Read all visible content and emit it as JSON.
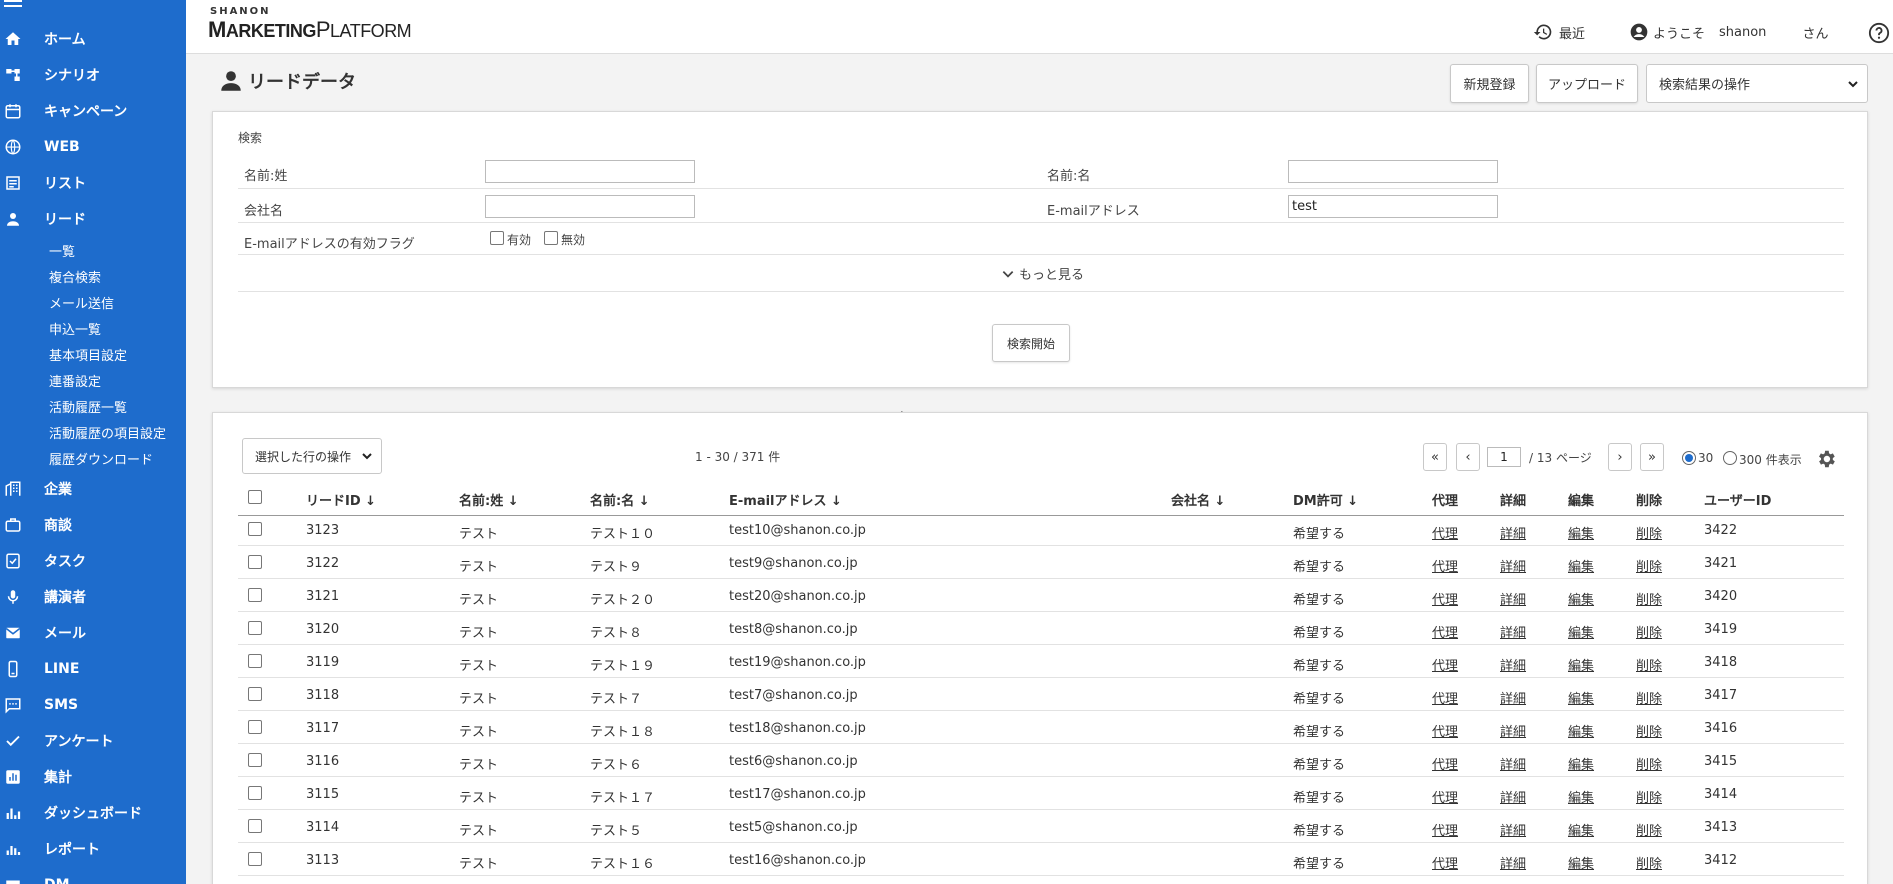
{
  "sidebar": {
    "items": [
      {
        "label": "ホーム",
        "icon": "home-icon"
      },
      {
        "label": "シナリオ",
        "icon": "scenario-icon"
      },
      {
        "label": "キャンペーン",
        "icon": "calendar-icon"
      },
      {
        "label": "WEB",
        "icon": "globe-icon"
      },
      {
        "label": "リスト",
        "icon": "list-icon"
      },
      {
        "label": "リード",
        "icon": "person-icon"
      },
      {
        "label": "企業",
        "icon": "building-icon"
      },
      {
        "label": "商談",
        "icon": "briefcase-icon"
      },
      {
        "label": "タスク",
        "icon": "task-icon"
      },
      {
        "label": "講演者",
        "icon": "mic-icon"
      },
      {
        "label": "メール",
        "icon": "mail-icon"
      },
      {
        "label": "LINE",
        "icon": "phone-icon"
      },
      {
        "label": "SMS",
        "icon": "sms-icon"
      },
      {
        "label": "アンケート",
        "icon": "check-icon"
      },
      {
        "label": "集計",
        "icon": "chart-icon"
      },
      {
        "label": "ダッシュボード",
        "icon": "bar-icon"
      },
      {
        "label": "レポート",
        "icon": "report-icon"
      },
      {
        "label": "DM",
        "icon": "dm-icon"
      }
    ],
    "sub_items": [
      "一覧",
      "複合検索",
      "メール送信",
      "申込一覧",
      "基本項目設定",
      "連番設定",
      "活動履歴一覧",
      "活動履歴の項目設定",
      "履歴ダウンロード"
    ]
  },
  "header": {
    "logo_top": "SHANON",
    "logo_main_1": "M",
    "logo_main_2": "ARKETING",
    "logo_main_3": "P",
    "logo_main_4": "LATFORM",
    "recent": "最近",
    "welcome": "ようこそ",
    "user": "shanon",
    "honorific": "さん"
  },
  "page": {
    "title": "リードデータ",
    "new_button": "新規登録",
    "upload_button": "アップロード",
    "results_action": "検索結果の操作"
  },
  "search": {
    "heading": "検索",
    "last_name_label": "名前:姓",
    "first_name_label": "名前:名",
    "company_label": "会社名",
    "email_label": "E-mailアドレス",
    "email_value": "test",
    "email_flag_label": "E-mailアドレスの有効フラグ",
    "valid_label": "有効",
    "invalid_label": "無効",
    "more": "もっと見る",
    "start_button": "検索開始"
  },
  "results": {
    "row_action": "選択した行の操作",
    "count_text": "1 - 30 / 371 件",
    "page_value": "1",
    "page_total": "/ 13 ページ",
    "per_page_30": "30",
    "per_page_300": "300 件表示",
    "columns": {
      "lead_id": "リードID ↓",
      "last_name": "名前:姓 ↓",
      "first_name": "名前:名 ↓",
      "email": "E-mailアドレス ↓",
      "company": "会社名 ↓",
      "dm": "DM許可 ↓",
      "proxy": "代理",
      "detail": "詳細",
      "edit": "編集",
      "delete": "削除",
      "user_id": "ユーザーID"
    },
    "rows": [
      {
        "id": "3123",
        "last": "テスト",
        "first": "テスト１０",
        "email": "test10@shanon.co.jp",
        "dm": "希望する",
        "proxy": "代理",
        "detail": "詳細",
        "edit": "編集",
        "del": "削除",
        "uid": "3422"
      },
      {
        "id": "3122",
        "last": "テスト",
        "first": "テスト９",
        "email": "test9@shanon.co.jp",
        "dm": "希望する",
        "proxy": "代理",
        "detail": "詳細",
        "edit": "編集",
        "del": "削除",
        "uid": "3421"
      },
      {
        "id": "3121",
        "last": "テスト",
        "first": "テスト２０",
        "email": "test20@shanon.co.jp",
        "dm": "希望する",
        "proxy": "代理",
        "detail": "詳細",
        "edit": "編集",
        "del": "削除",
        "uid": "3420"
      },
      {
        "id": "3120",
        "last": "テスト",
        "first": "テスト８",
        "email": "test8@shanon.co.jp",
        "dm": "希望する",
        "proxy": "代理",
        "detail": "詳細",
        "edit": "編集",
        "del": "削除",
        "uid": "3419"
      },
      {
        "id": "3119",
        "last": "テスト",
        "first": "テスト１９",
        "email": "test19@shanon.co.jp",
        "dm": "希望する",
        "proxy": "代理",
        "detail": "詳細",
        "edit": "編集",
        "del": "削除",
        "uid": "3418"
      },
      {
        "id": "3118",
        "last": "テスト",
        "first": "テスト７",
        "email": "test7@shanon.co.jp",
        "dm": "希望する",
        "proxy": "代理",
        "detail": "詳細",
        "edit": "編集",
        "del": "削除",
        "uid": "3417"
      },
      {
        "id": "3117",
        "last": "テスト",
        "first": "テスト１８",
        "email": "test18@shanon.co.jp",
        "dm": "希望する",
        "proxy": "代理",
        "detail": "詳細",
        "edit": "編集",
        "del": "削除",
        "uid": "3416"
      },
      {
        "id": "3116",
        "last": "テスト",
        "first": "テスト６",
        "email": "test6@shanon.co.jp",
        "dm": "希望する",
        "proxy": "代理",
        "detail": "詳細",
        "edit": "編集",
        "del": "削除",
        "uid": "3415"
      },
      {
        "id": "3115",
        "last": "テスト",
        "first": "テスト１７",
        "email": "test17@shanon.co.jp",
        "dm": "希望する",
        "proxy": "代理",
        "detail": "詳細",
        "edit": "編集",
        "del": "削除",
        "uid": "3414"
      },
      {
        "id": "3114",
        "last": "テスト",
        "first": "テスト５",
        "email": "test5@shanon.co.jp",
        "dm": "希望する",
        "proxy": "代理",
        "detail": "詳細",
        "edit": "編集",
        "del": "削除",
        "uid": "3413"
      },
      {
        "id": "3113",
        "last": "テスト",
        "first": "テスト１６",
        "email": "test16@shanon.co.jp",
        "dm": "希望する",
        "proxy": "代理",
        "detail": "詳細",
        "edit": "編集",
        "del": "削除",
        "uid": "3412"
      }
    ]
  },
  "colors": {
    "sidebar": "#1e6ccc",
    "accent": "#1e6ccc"
  }
}
